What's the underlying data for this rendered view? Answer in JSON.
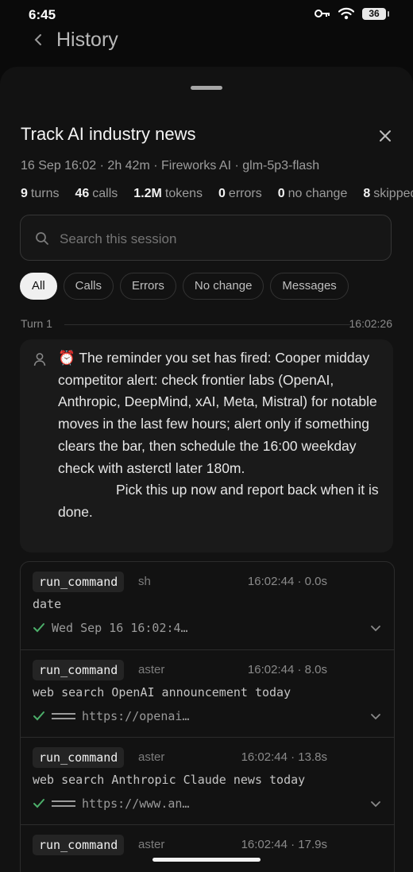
{
  "status_bar": {
    "time": "6:45",
    "battery": "36"
  },
  "header": {
    "title": "History"
  },
  "session": {
    "title": "Track AI industry news",
    "meta": "16 Sep 16:02 · 2h 42m · Fireworks AI · glm-5p3-flash",
    "stats": [
      {
        "value": "9",
        "label": "turns"
      },
      {
        "value": "46",
        "label": "calls"
      },
      {
        "value": "1.2M",
        "label": "tokens"
      },
      {
        "value": "0",
        "label": "errors"
      },
      {
        "value": "0",
        "label": "no change"
      },
      {
        "value": "8",
        "label": "skipped"
      }
    ]
  },
  "search": {
    "placeholder": "Search this session"
  },
  "filters": [
    "All",
    "Calls",
    "Errors",
    "No change",
    "Messages"
  ],
  "turn": {
    "label": "Turn 1",
    "time": "16:02:26"
  },
  "message": {
    "text": "⏰ The reminder you set has fired: Cooper midday competitor alert: check frontier labs (OpenAI, Anthropic, DeepMind, xAI, Meta, Mistral) for notable moves in the last few hours; alert only if something clears the bar, then schedule the 16:00 weekday check with asterctl later 180m.\n               Pick this up now and report back when it is done."
  },
  "calls": [
    {
      "tool": "run_command",
      "kind": "sh",
      "time": "16:02:44 · 0.0s",
      "command": "date",
      "result": "Wed Sep 16 16:02:4…",
      "has_rule": false
    },
    {
      "tool": "run_command",
      "kind": "aster",
      "time": "16:02:44 · 8.0s",
      "command": "web search OpenAI announcement today",
      "result": "https://openai…",
      "has_rule": true
    },
    {
      "tool": "run_command",
      "kind": "aster",
      "time": "16:02:44 · 13.8s",
      "command": "web search Anthropic Claude news today",
      "result": "https://www.an…",
      "has_rule": true
    },
    {
      "tool": "run_command",
      "kind": "aster",
      "time": "16:02:44 · 17.9s",
      "command": "",
      "result": "",
      "has_rule": false
    }
  ],
  "colors": {
    "background": "#0a0a0a",
    "sheet": "#121212",
    "success": "#4caf6a"
  }
}
